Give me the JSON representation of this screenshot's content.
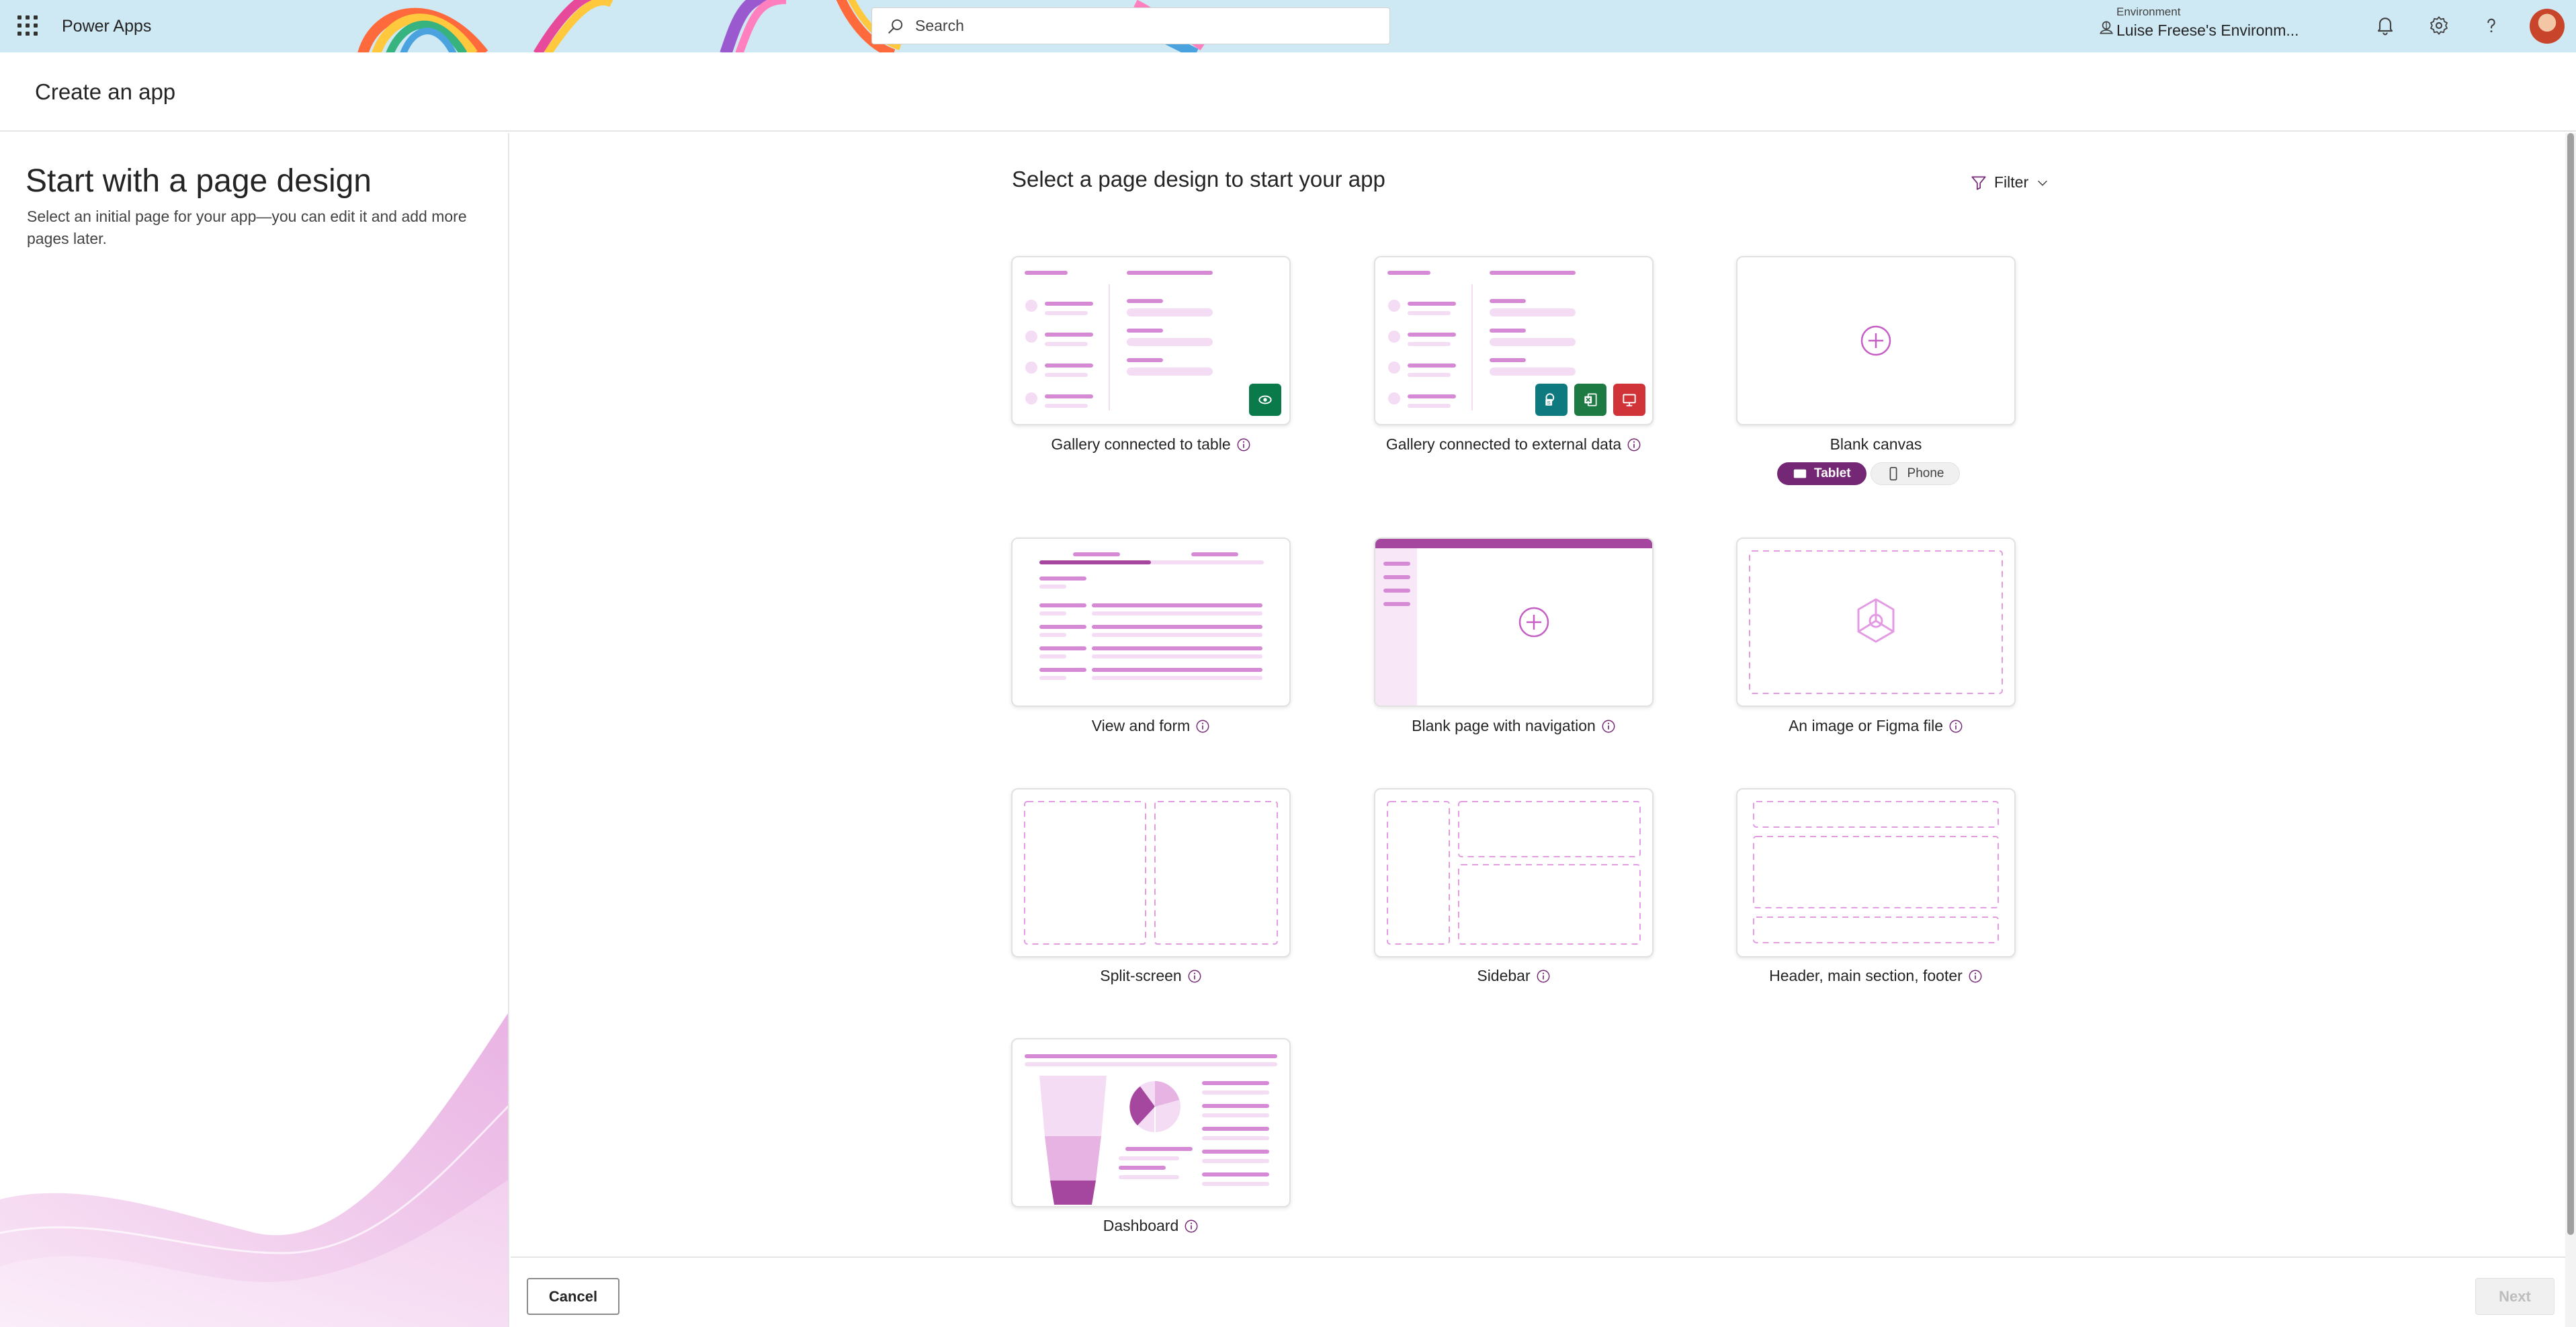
{
  "topbar": {
    "app_name": "Power Apps",
    "search_placeholder": "Search",
    "environment_label": "Environment",
    "environment_name": "Luise Freese's Environm...",
    "icons": [
      "waffle-icon",
      "environment-icon",
      "bell-icon",
      "gear-icon",
      "help-icon",
      "avatar"
    ]
  },
  "header": {
    "title": "Create an app"
  },
  "left_pane": {
    "title": "Start with a page design",
    "description": "Select an initial page for your app—you can edit it and add more pages later."
  },
  "main": {
    "title": "Select a page design to start your app",
    "filter_label": "Filter",
    "cards": {
      "gallery_table": "Gallery connected to table",
      "gallery_external": "Gallery connected to external data",
      "blank_canvas": "Blank canvas",
      "view_form": "View and form",
      "blank_nav": "Blank page with navigation",
      "image_figma": "An image or Figma file",
      "split_screen": "Split-screen",
      "sidebar": "Sidebar",
      "header_main_footer": "Header, main section, footer",
      "dashboard": "Dashboard"
    },
    "layout_toggle": {
      "tablet": "Tablet",
      "phone": "Phone",
      "selected": "Tablet"
    }
  },
  "footer": {
    "cancel_label": "Cancel",
    "next_label": "Next",
    "next_disabled": true
  },
  "colors": {
    "brand": "#742774",
    "thumb_line": "#d68ad6",
    "thumb_light": "#f4dcf4",
    "dataverse_green": "#0a7a4a",
    "excel_green": "#1d7a43",
    "sharepoint_teal": "#0e7a80",
    "red": "#d13438",
    "topbar_bg": "#cfe9f4"
  }
}
